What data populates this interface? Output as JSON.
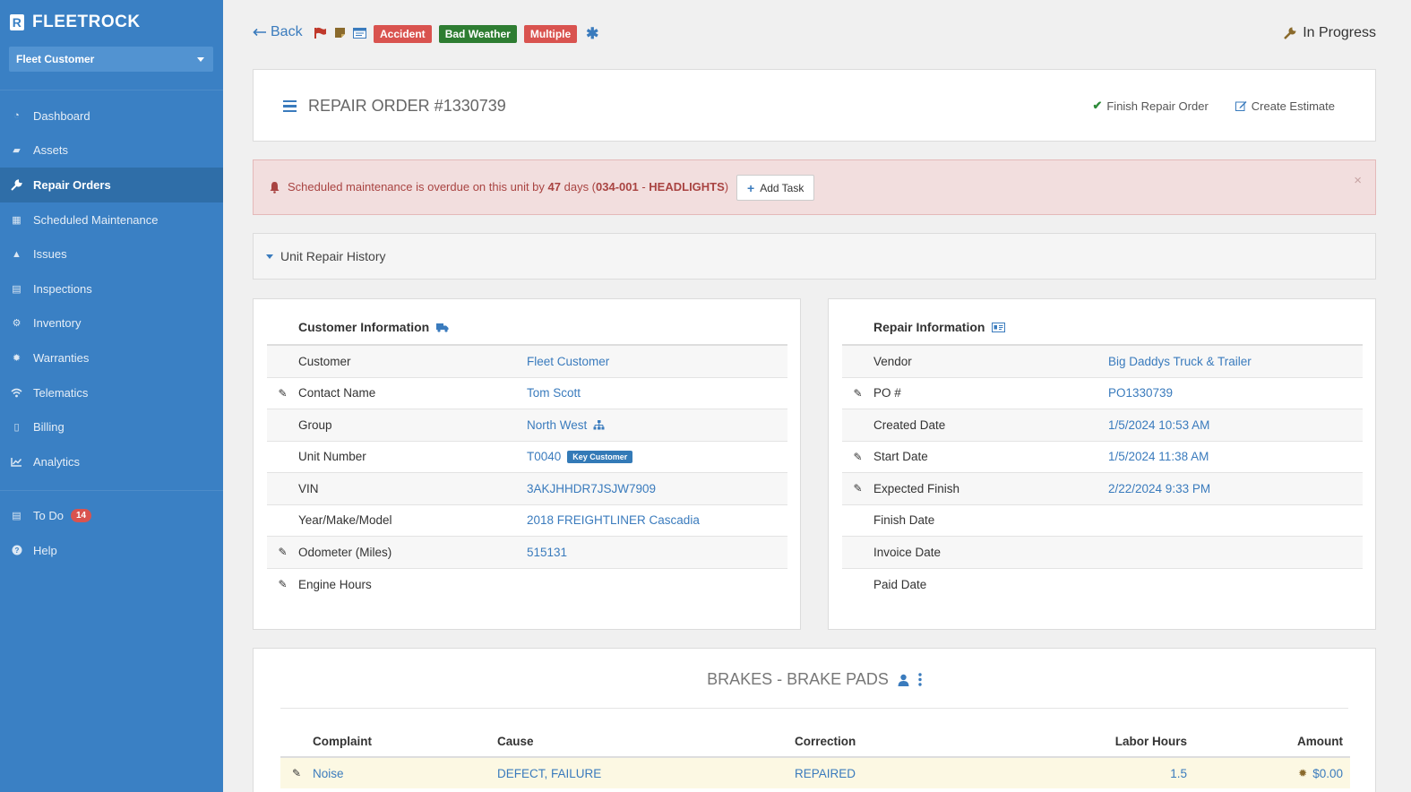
{
  "brand": {
    "name": "FLEETROCK",
    "logo_letter": "R"
  },
  "customer_select": {
    "value": "Fleet Customer"
  },
  "nav": {
    "items": [
      {
        "label": "Dashboard",
        "icon": "dashboard-icon"
      },
      {
        "label": "Assets",
        "icon": "truck-icon"
      },
      {
        "label": "Repair Orders",
        "icon": "wrench-icon",
        "active": true
      },
      {
        "label": "Scheduled Maintenance",
        "icon": "calendar-icon"
      },
      {
        "label": "Issues",
        "icon": "warning-icon"
      },
      {
        "label": "Inspections",
        "icon": "list-icon"
      },
      {
        "label": "Inventory",
        "icon": "gears-icon"
      },
      {
        "label": "Warranties",
        "icon": "certificate-icon"
      },
      {
        "label": "Telematics",
        "icon": "wifi-icon"
      },
      {
        "label": "Billing",
        "icon": "file-icon"
      },
      {
        "label": "Analytics",
        "icon": "chart-icon"
      }
    ],
    "todo": {
      "label": "To Do",
      "count": "14"
    },
    "help": {
      "label": "Help"
    }
  },
  "topbar": {
    "back_label": "Back",
    "tags": [
      {
        "label": "Accident",
        "color": "#d9534f"
      },
      {
        "label": "Bad Weather",
        "color": "#2e7d32"
      },
      {
        "label": "Multiple",
        "color": "#d9534f"
      }
    ],
    "status": "In Progress"
  },
  "repair_order": {
    "title": "REPAIR ORDER #1330739",
    "finish_label": "Finish Repair Order",
    "estimate_label": "Create Estimate"
  },
  "alert": {
    "prefix": "Scheduled maintenance is overdue on this unit by ",
    "days": "47",
    "middle": " days (",
    "code": "034-001",
    "dash": " - ",
    "item": "HEADLIGHTS",
    "suffix": ")",
    "add_task_label": "Add Task",
    "close_glyph": "×"
  },
  "history": {
    "label": "Unit Repair History"
  },
  "customer_info": {
    "title": "Customer Information",
    "rows": [
      {
        "label": "Customer",
        "value": "Fleet Customer"
      },
      {
        "label": "Contact Name",
        "value": "Tom Scott"
      },
      {
        "label": "Group",
        "value": "North West"
      },
      {
        "label": "Unit Number",
        "value": "T0040",
        "badge": "Key Customer"
      },
      {
        "label": "VIN",
        "value": "3AKJHHDR7JSJW7909"
      },
      {
        "label": "Year/Make/Model",
        "value": "2018 FREIGHTLINER Cascadia"
      },
      {
        "label": "Odometer (Miles)",
        "value": "515131"
      },
      {
        "label": "Engine Hours",
        "value": ""
      }
    ]
  },
  "repair_info": {
    "title": "Repair Information",
    "rows": [
      {
        "label": "Vendor",
        "value": "Big Daddys Truck & Trailer"
      },
      {
        "label": "PO #",
        "value": "PO1330739"
      },
      {
        "label": "Created Date",
        "value": "1/5/2024 10:53 AM"
      },
      {
        "label": "Start Date",
        "value": "1/5/2024 11:38 AM"
      },
      {
        "label": "Expected Finish",
        "value": "2/22/2024 9:33 PM"
      },
      {
        "label": "Finish Date",
        "value": ""
      },
      {
        "label": "Invoice Date",
        "value": ""
      },
      {
        "label": "Paid Date",
        "value": ""
      }
    ]
  },
  "job": {
    "title": "BRAKES - BRAKE PADS",
    "columns": {
      "complaint": "Complaint",
      "cause": "Cause",
      "correction": "Correction",
      "hours": "Labor Hours",
      "amount": "Amount"
    },
    "rows": [
      {
        "complaint": "Noise",
        "cause": "DEFECT, FAILURE",
        "correction": "REPAIRED",
        "hours": "1.5",
        "amount": "$0.00"
      }
    ]
  }
}
